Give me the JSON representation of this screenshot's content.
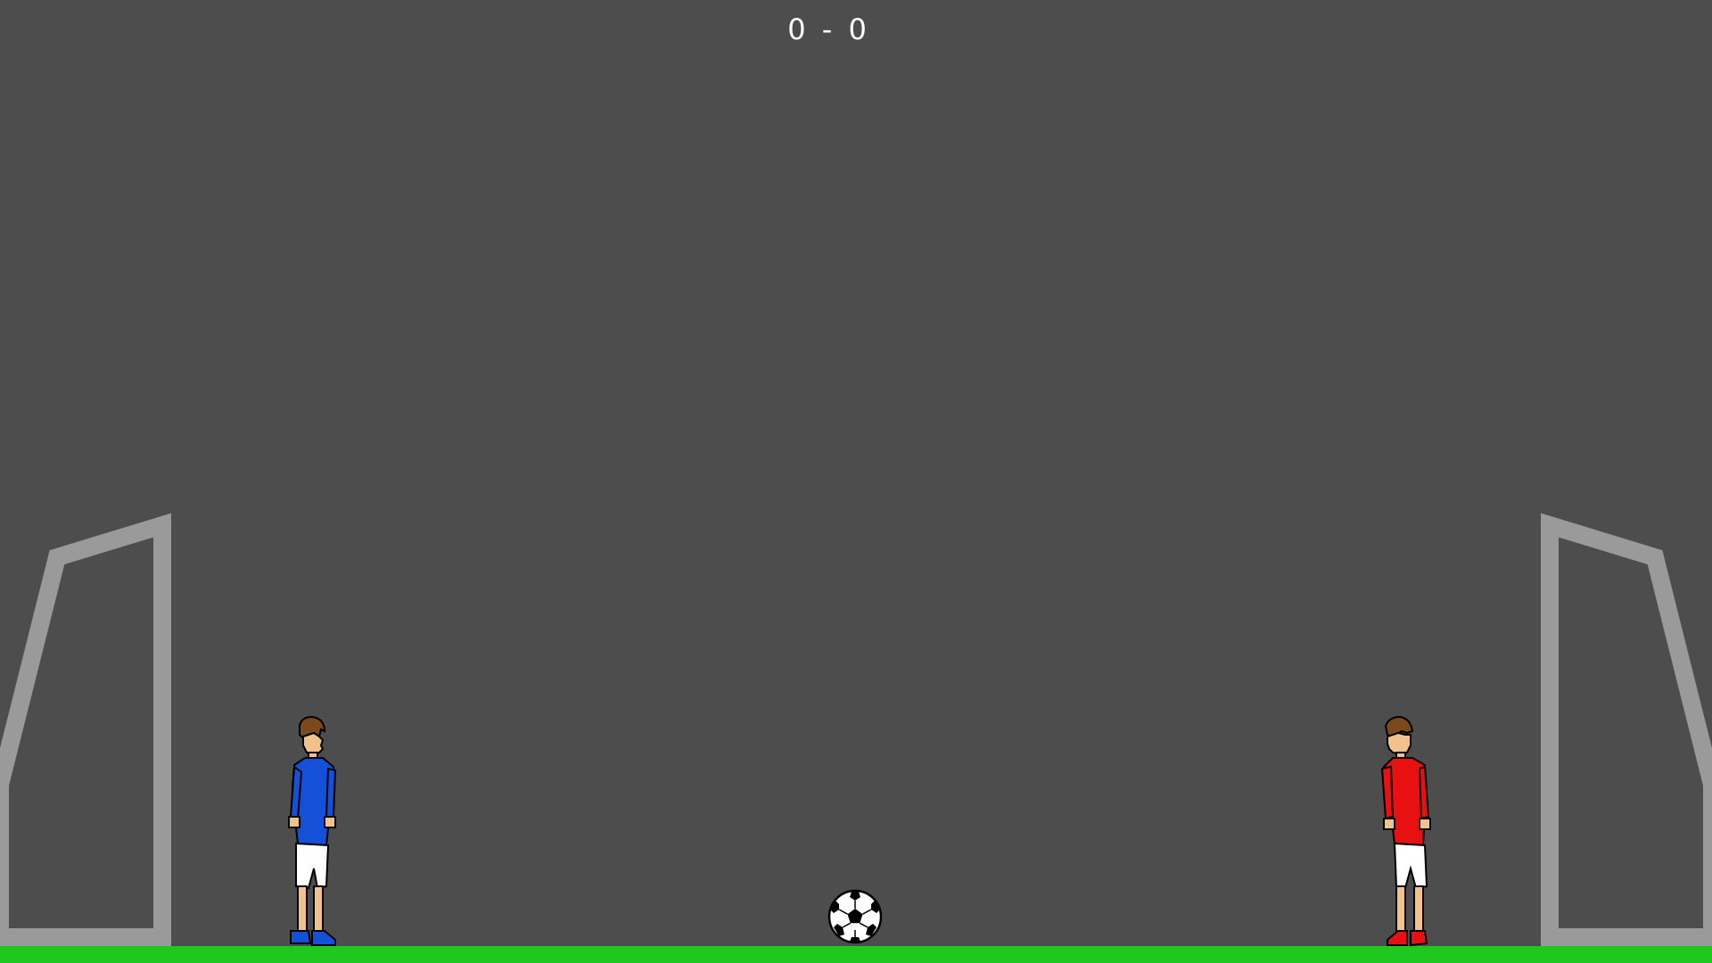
{
  "score": {
    "left": "0",
    "separator": "-",
    "right": "0"
  },
  "colors": {
    "background": "#4d4d4d",
    "grass": "#1ec81e",
    "goal_frame": "#9a9a9a",
    "left_team_shirt": "#1550d8",
    "right_team_shirt": "#e81010",
    "shorts": "#ffffff",
    "skin": "#f2c28c",
    "hair": "#7a4a1c"
  },
  "players": [
    {
      "team": "blue",
      "side": "left",
      "icon": "blue-player-icon"
    },
    {
      "team": "red",
      "side": "right",
      "icon": "red-player-icon"
    }
  ],
  "ball": {
    "icon": "soccer-ball-icon"
  }
}
